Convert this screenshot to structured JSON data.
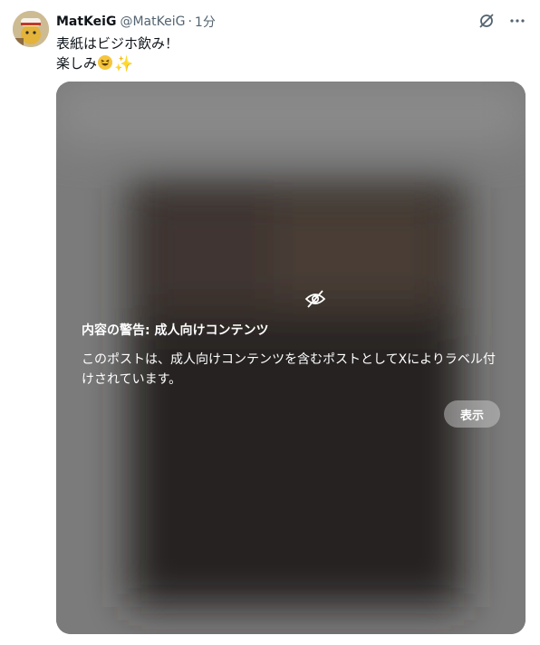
{
  "post": {
    "display_name": "MatKeiG",
    "handle": "@MatKeiG",
    "separator": "·",
    "time": "1分",
    "text_line1": "表紙はビジホ飲み！",
    "text_line2": "楽しみ"
  },
  "icons": {
    "grok": "grok-icon",
    "more": "more-icon",
    "hidden": "eye-slash-icon",
    "emoji1": "grinning-squinting-face-emoji",
    "emoji2": "sparkles-emoji"
  },
  "sensitive_media": {
    "title": "内容の警告: 成人向けコンテンツ",
    "body": "このポストは、成人向けコンテンツを含むポストとしてXによりラベル付けされています。",
    "show_button": "表示"
  },
  "colors": {
    "text": "#0f1419",
    "secondary": "#536471",
    "overlay": "#7a7a7a",
    "button": "rgba(215,215,215,0.45)"
  }
}
